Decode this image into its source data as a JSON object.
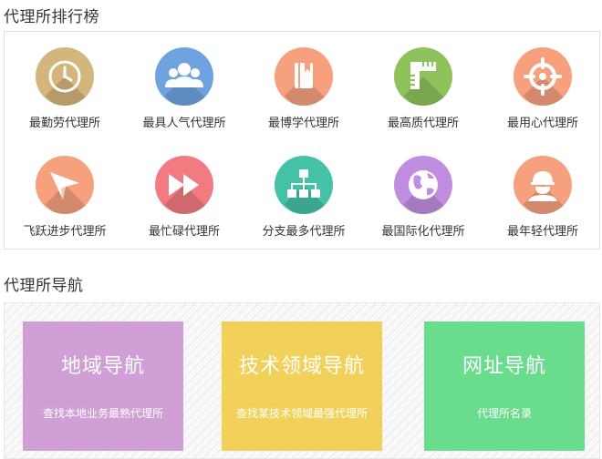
{
  "ranking": {
    "title": "代理所排行榜",
    "items": [
      {
        "label": "最勤劳代理所",
        "icon": "clock-icon",
        "color": "#d4b57c"
      },
      {
        "label": "最具人气代理所",
        "icon": "people-icon",
        "color": "#6fa3df"
      },
      {
        "label": "最博学代理所",
        "icon": "book-icon",
        "color": "#f6a07e"
      },
      {
        "label": "最高质代理所",
        "icon": "ruler-icon",
        "color": "#8ec35b"
      },
      {
        "label": "最用心代理所",
        "icon": "target-icon",
        "color": "#f6a07e"
      },
      {
        "label": "飞跃进步代理所",
        "icon": "paper-plane-icon",
        "color": "#f6a07e"
      },
      {
        "label": "最忙碌代理所",
        "icon": "fast-forward-icon",
        "color": "#f17b80"
      },
      {
        "label": "分支最多代理所",
        "icon": "hierarchy-icon",
        "color": "#44c2a5"
      },
      {
        "label": "最国际化代理所",
        "icon": "globe-icon",
        "color": "#c08ee0"
      },
      {
        "label": "最年轻代理所",
        "icon": "worker-icon",
        "color": "#f6a07e"
      }
    ]
  },
  "navigation": {
    "title": "代理所导航",
    "cards": [
      {
        "title": "地域导航",
        "desc": "查找本地业务最熟代理所",
        "color": "#cf9fd6"
      },
      {
        "title": "技术领域导航",
        "desc": "查找某技术领域最强代理所",
        "color": "#f1d15a"
      },
      {
        "title": "网址导航",
        "desc": "代理所名录",
        "color": "#6adc8e"
      }
    ]
  }
}
